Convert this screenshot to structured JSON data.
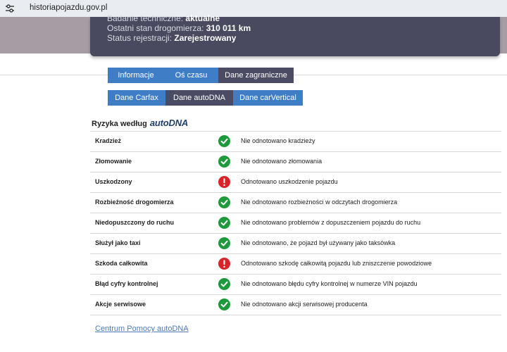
{
  "browser": {
    "url": "historiapojazdu.gov.pl"
  },
  "vehicle_card": {
    "lines": [
      {
        "label": "Badanie techniczne:",
        "value": "aktualne"
      },
      {
        "label": "Ostatni stan drogomierza:",
        "value": "310 011 km"
      },
      {
        "label": "Status rejestracji:",
        "value": "Zarejestrowany"
      }
    ]
  },
  "tabs_row1": [
    "Informacje",
    "Oś czasu",
    "Dane zagraniczne"
  ],
  "tabs_row2": [
    "Dane Carfax",
    "Dane autoDNA",
    "Dane carVertical"
  ],
  "risk_section": {
    "title": "Ryzyka według",
    "brand": "autoDNA"
  },
  "risks": [
    {
      "label": "Kradzież",
      "status": "ok",
      "status_icon": "check-circle-icon",
      "description": "Nie odnotowano kradzieży"
    },
    {
      "label": "Złomowanie",
      "status": "ok",
      "status_icon": "check-circle-icon",
      "description": "Nie odnotowano złomowania"
    },
    {
      "label": "Uszkodzony",
      "status": "warning",
      "status_icon": "exclamation-circle-icon",
      "description": "Odnotowano uszkodzenie pojazdu"
    },
    {
      "label": "Rozbieżność drogomierza",
      "status": "ok",
      "status_icon": "check-circle-icon",
      "description": "Nie odnotowano rozbieżności w odczytach drogomierza"
    },
    {
      "label": "Niedopuszczony do ruchu",
      "status": "ok",
      "status_icon": "check-circle-icon",
      "description": "Nie odnotowano problemów z dopuszczeniem pojazdu do ruchu"
    },
    {
      "label": "Służył jako taxi",
      "status": "ok",
      "status_icon": "check-circle-icon",
      "description": "Nie odnotowano, że pojazd był używany jako taksówka"
    },
    {
      "label": "Szkoda całkowita",
      "status": "warning",
      "status_icon": "exclamation-circle-icon",
      "description": "Odnotowano szkodę całkowitą pojazdu lub zniszczenie powodziowe"
    },
    {
      "label": "Błąd cyfry kontrolnej",
      "status": "ok",
      "status_icon": "check-circle-icon",
      "description": "Nie odnotowano błędu cyfry kontrolnej w numerze VIN pojazdu"
    },
    {
      "label": "Akcje serwisowe",
      "status": "ok",
      "status_icon": "check-circle-icon",
      "description": "Nie odnotowano akcji serwisowej producenta"
    }
  ],
  "help_link": "Centrum Pomocy autoDNA",
  "colors": {
    "ok": "#1e9a3c",
    "warning": "#d9232a",
    "tab_active": "#4b4c63",
    "tab_inactive": "#3f7ec6",
    "card": "#494a5f"
  }
}
